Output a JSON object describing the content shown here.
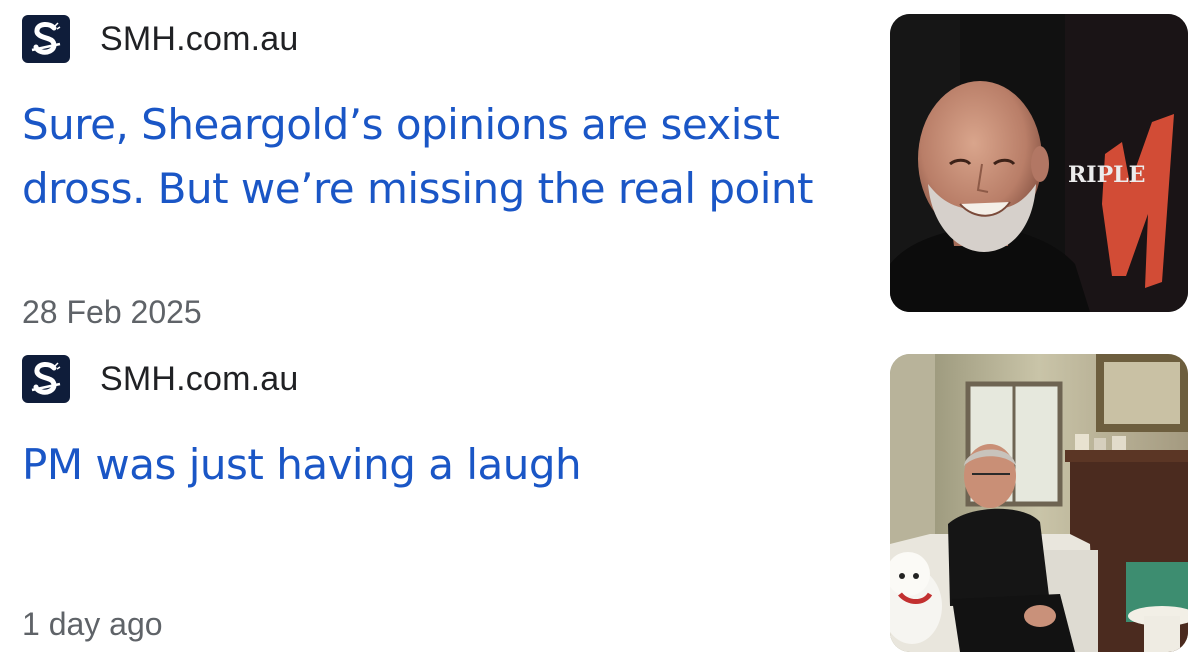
{
  "articles": [
    {
      "source": "SMH.com.au",
      "source_icon": "smh-logo-icon",
      "headline": "Sure, Sheargold’s opinions are sexist dross. But we’re missing the real point",
      "timestamp": "28 Feb 2025",
      "thumbnail": {
        "icon": "man-portrait-photo",
        "sign_text": "RIPLE"
      }
    },
    {
      "source": "SMH.com.au",
      "source_icon": "smh-logo-icon",
      "headline": "PM was just having a laugh",
      "timestamp": "1 day ago",
      "thumbnail": {
        "icon": "man-in-living-room-photo"
      }
    }
  ],
  "colors": {
    "headline": "#1a56c6",
    "source_text": "#202124",
    "timestamp": "#5f6368",
    "logo_bg": "#0f1d3a"
  }
}
